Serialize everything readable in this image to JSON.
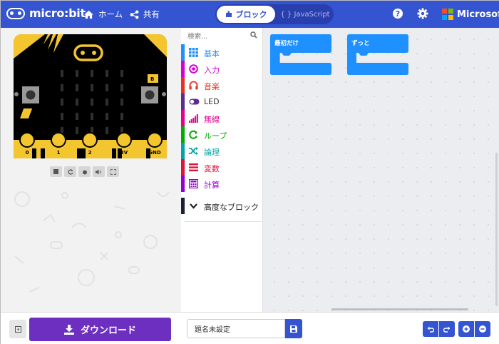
{
  "app": {
    "logo_text": "micro:bit"
  },
  "header": {
    "home_label": "ホーム",
    "share_label": "共有",
    "blocks_tab": "ブロック",
    "js_tab": "{ } JavaScript",
    "brand": "Microsoft"
  },
  "colors": {
    "topbar": "#3454d1",
    "download": "#6d2fbf",
    "block_blue": "#1e90ff",
    "board_yellow": "#f3c52e"
  },
  "board": {
    "pins": [
      "0",
      "1",
      "2",
      "3V",
      "GND"
    ],
    "button_a": "A",
    "button_b": "B"
  },
  "sim_controls": [
    "stop-icon",
    "restart-icon",
    "debug-icon",
    "sound-icon",
    "fullscreen-icon"
  ],
  "toolbox": {
    "search_placeholder": "検索...",
    "categories": [
      {
        "label": "基本",
        "color": "#1e90ff",
        "icon": "grid-icon"
      },
      {
        "label": "入力",
        "color": "#d400d4",
        "icon": "input-icon"
      },
      {
        "label": "音楽",
        "color": "#e63022",
        "icon": "headphones-icon"
      },
      {
        "label": "LED",
        "color": "#5c2d91",
        "icon": "toggle-icon"
      },
      {
        "label": "無線",
        "color": "#e3008c",
        "icon": "signal-icon"
      },
      {
        "label": "ループ",
        "color": "#00aa00",
        "icon": "refresh-icon"
      },
      {
        "label": "論理",
        "color": "#00a4a6",
        "icon": "shuffle-icon"
      },
      {
        "label": "変数",
        "color": "#dc143c",
        "icon": "list-icon"
      },
      {
        "label": "計算",
        "color": "#9400d3",
        "icon": "calculator-icon"
      }
    ],
    "advanced_label": "高度なブロック"
  },
  "workspace": {
    "blocks": [
      {
        "label": "最初だけ"
      },
      {
        "label": "ずっと"
      }
    ]
  },
  "footer": {
    "download_label": "ダウンロード",
    "project_name": "題名未設定"
  }
}
